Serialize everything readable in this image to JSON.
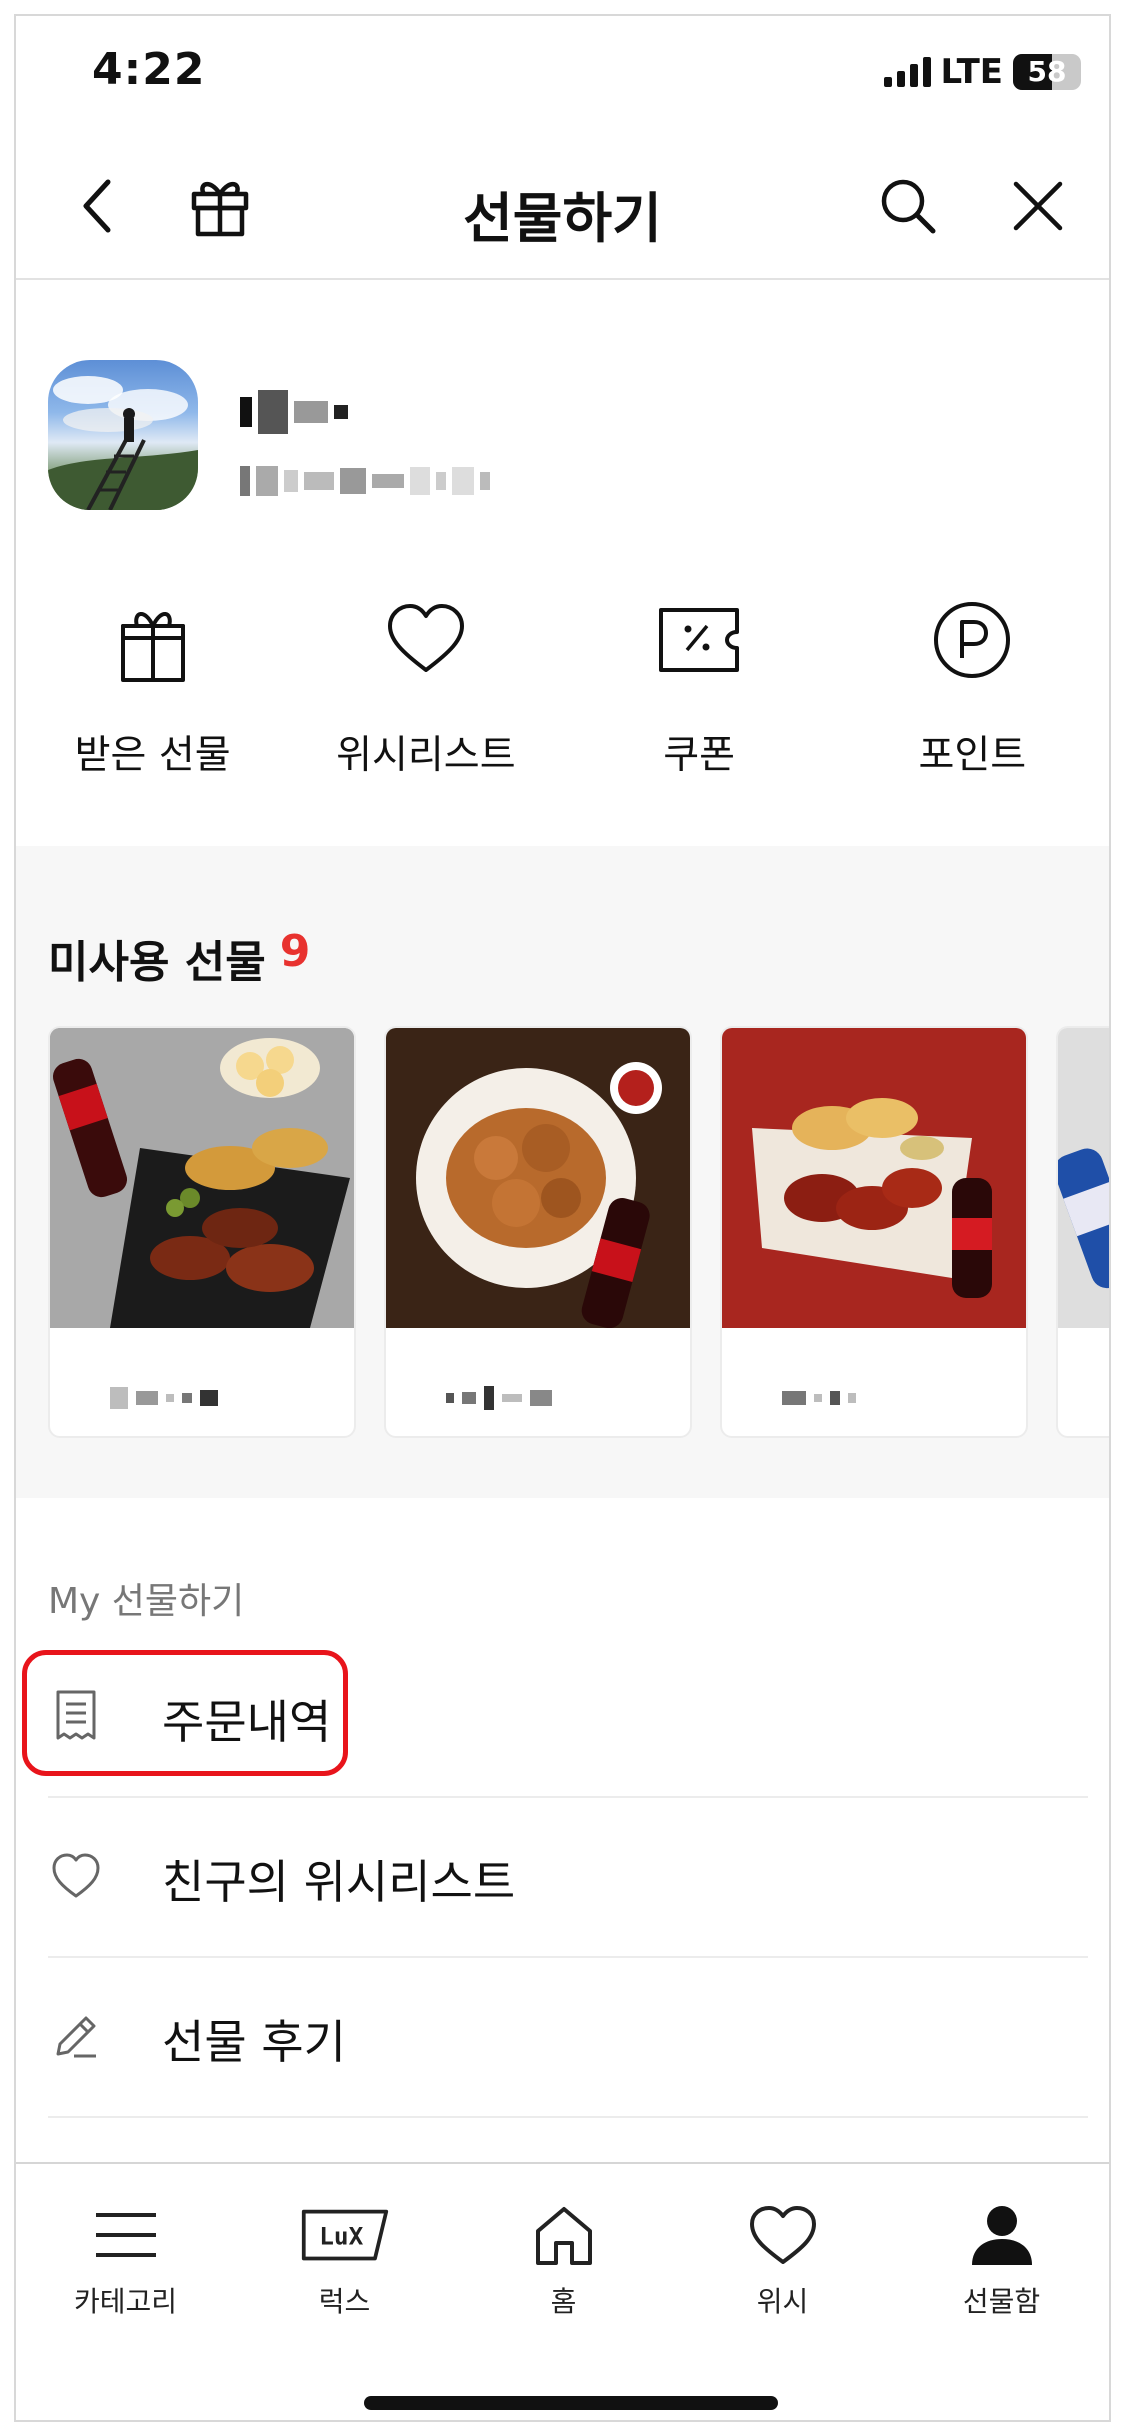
{
  "status_bar": {
    "time": "4:22",
    "network": "LTE",
    "battery": "58",
    "battery_level": 0.58
  },
  "header": {
    "title": "선물하기"
  },
  "quick_menu": [
    {
      "label": "받은 선물",
      "icon": "gift-icon"
    },
    {
      "label": "위시리스트",
      "icon": "heart-icon"
    },
    {
      "label": "쿠폰",
      "icon": "coupon-icon"
    },
    {
      "label": "포인트",
      "icon": "point-icon"
    }
  ],
  "unused_gifts": {
    "title": "미사용 선물",
    "count": "9"
  },
  "my_section": {
    "title": "My 선물하기",
    "items": [
      {
        "label": "주문내역",
        "icon": "receipt-icon",
        "highlighted": true
      },
      {
        "label": "친구의 위시리스트",
        "icon": "heart-outline-icon"
      },
      {
        "label": "선물 후기",
        "icon": "pencil-icon"
      }
    ]
  },
  "tab_bar": [
    {
      "label": "카테고리",
      "icon": "menu-icon"
    },
    {
      "label": "럭스",
      "icon": "lux-icon",
      "icon_text": "LuX"
    },
    {
      "label": "홈",
      "icon": "home-icon"
    },
    {
      "label": "위시",
      "icon": "heart-icon"
    },
    {
      "label": "선물함",
      "icon": "person-icon",
      "active": true
    }
  ],
  "colors": {
    "accent_red": "#e8322f",
    "highlight_border": "#e8141b",
    "section_bg": "#f7f7f7"
  }
}
